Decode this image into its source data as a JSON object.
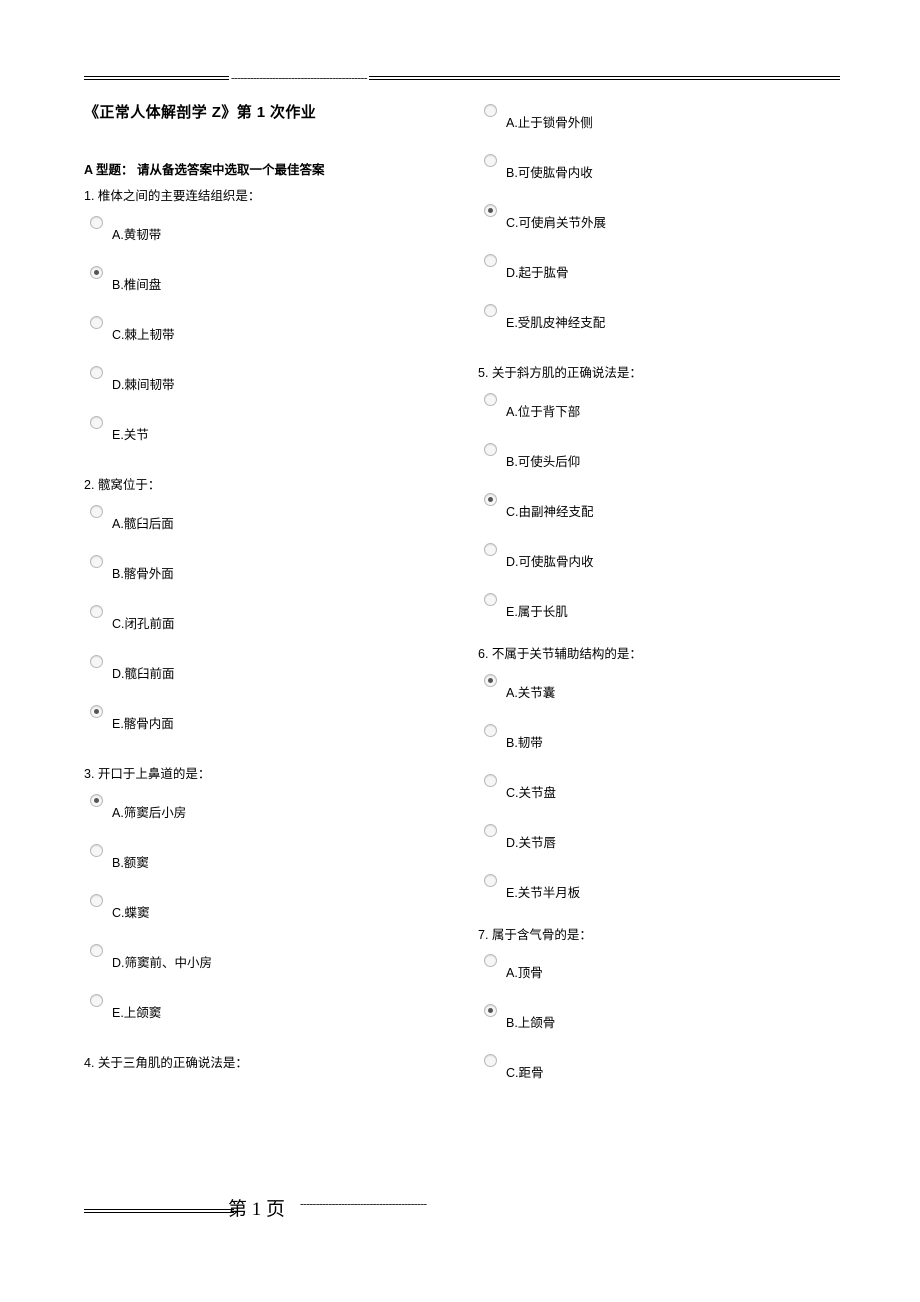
{
  "document": {
    "title": "《正常人体解剖学 Z》第 1 次作业",
    "intro": "A 型题：  请从备选答案中选取一个最佳答案",
    "top_divider": "-------------------------------------------",
    "footer": {
      "page_label": "第  1  页",
      "dashes": "----------------------------------------"
    }
  },
  "left_column": [
    {
      "number": "1.",
      "text": "1. 椎体之间的主要连结组织是：",
      "options": [
        {
          "label": "A.黄韧带",
          "checked": false
        },
        {
          "label": "B.椎间盘",
          "checked": true
        },
        {
          "label": "C.棘上韧带",
          "checked": false
        },
        {
          "label": "D.棘间韧带",
          "checked": false
        },
        {
          "label": "E.关节",
          "checked": false
        }
      ]
    },
    {
      "number": "2.",
      "text": "2. 髋窝位于：",
      "options": [
        {
          "label": "A.髋臼后面",
          "checked": false
        },
        {
          "label": "B.髂骨外面",
          "checked": false
        },
        {
          "label": "C.闭孔前面",
          "checked": false
        },
        {
          "label": "D.髋臼前面",
          "checked": false
        },
        {
          "label": "E.髂骨内面",
          "checked": true
        }
      ]
    },
    {
      "number": "3.",
      "text": "3. 开口于上鼻道的是：",
      "options": [
        {
          "label": "A.筛窦后小房",
          "checked": true
        },
        {
          "label": "B.额窦",
          "checked": false
        },
        {
          "label": "C.蝶窦",
          "checked": false
        },
        {
          "label": "D.筛窦前、中小房",
          "checked": false
        },
        {
          "label": "E.上颌窦",
          "checked": false
        }
      ]
    },
    {
      "number": "4.",
      "text": "4. 关于三角肌的正确说法是：",
      "options": []
    }
  ],
  "right_column": [
    {
      "number": "4-cont",
      "text": "",
      "options": [
        {
          "label": "A.止于锁骨外侧",
          "checked": false
        },
        {
          "label": "B.可使肱骨内收",
          "checked": false
        },
        {
          "label": "C.可使肩关节外展",
          "checked": true
        },
        {
          "label": "D.起于肱骨",
          "checked": false
        },
        {
          "label": "E.受肌皮神经支配",
          "checked": false
        }
      ]
    },
    {
      "number": "5.",
      "text": "5. 关于斜方肌的正确说法是：",
      "options": [
        {
          "label": "A.位于背下部",
          "checked": false
        },
        {
          "label": "B.可使头后仰",
          "checked": false
        },
        {
          "label": "C.由副神经支配",
          "checked": true
        },
        {
          "label": "D.可使肱骨内收",
          "checked": false
        },
        {
          "label": "E.属于长肌",
          "checked": false
        }
      ]
    },
    {
      "number": "6.",
      "text": "6. 不属于关节辅助结构的是：",
      "options": [
        {
          "label": "A.关节囊",
          "checked": true
        },
        {
          "label": "B.韧带",
          "checked": false
        },
        {
          "label": "C.关节盘",
          "checked": false
        },
        {
          "label": "D.关节唇",
          "checked": false
        },
        {
          "label": "E.关节半月板",
          "checked": false
        }
      ]
    },
    {
      "number": "7.",
      "text": "7. 属于含气骨的是：",
      "options": [
        {
          "label": "A.顶骨",
          "checked": false
        },
        {
          "label": "B.上颌骨",
          "checked": true
        },
        {
          "label": "C.距骨",
          "checked": false
        }
      ]
    }
  ]
}
